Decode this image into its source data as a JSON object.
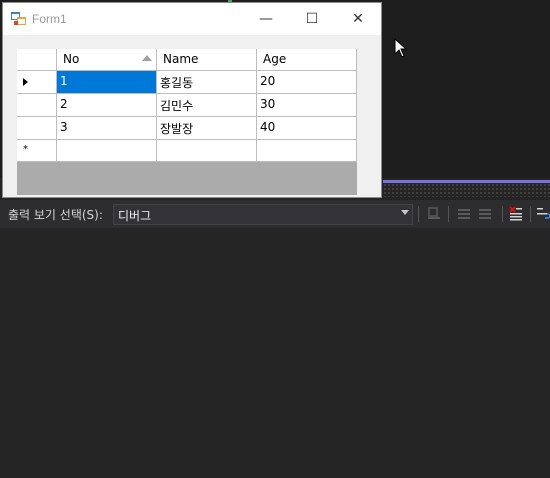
{
  "window": {
    "title": "Form1",
    "controls": {
      "minimize": "—",
      "maximize": "☐",
      "close": "✕"
    }
  },
  "grid": {
    "columns": [
      "No",
      "Name",
      "Age"
    ],
    "sorted_column": "No",
    "rows": [
      [
        "1",
        "홍길동",
        "20"
      ],
      [
        "2",
        "김민수",
        "30"
      ],
      [
        "3",
        "장발장",
        "40"
      ]
    ],
    "new_row_marker": "*",
    "selected_cell": {
      "row": 0,
      "col": 0
    }
  },
  "output_panel": {
    "label": "출력 보기 선택(S):",
    "selected_source": "디버그"
  },
  "colors": {
    "selection": "#0078d7",
    "ide_background": "#1e1e1e",
    "panel_background": "#2d2d30",
    "accent_purple": "#7c6fe0"
  }
}
